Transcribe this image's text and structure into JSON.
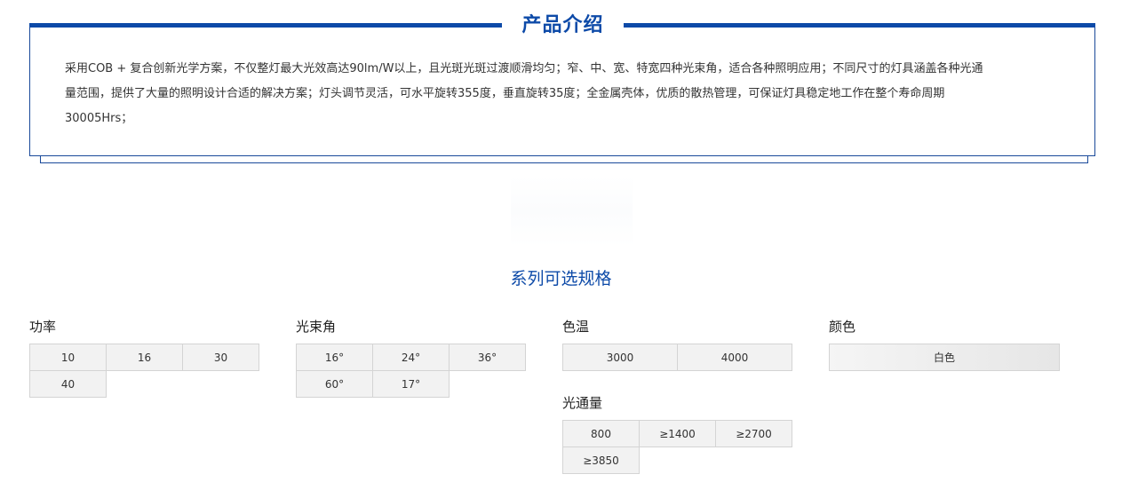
{
  "intro": {
    "title": "产品介绍",
    "line1": "采用COB + 复合创新光学方案，不仅整灯最大光效高达90lm/W以上，且光斑光斑过渡顺滑均匀；窄、中、宽、特宽四种光束角，适合各种照明应用；不同尺寸的灯具涵盖各种光通",
    "line2": "量范围，提供了大量的照明设计合适的解决方案；灯头调节灵活，可水平旋转355度，垂直旋转35度；全金属壳体，优质的散热管理，可保证灯具稳定地工作在整个寿命周期",
    "line3": "30005Hrs；"
  },
  "series": {
    "title": "系列可选规格",
    "power": {
      "label": "功率",
      "options": [
        "10",
        "16",
        "30",
        "40"
      ]
    },
    "beam": {
      "label": "光束角",
      "options": [
        "16°",
        "24°",
        "36°",
        "60°",
        "17°"
      ]
    },
    "cct": {
      "label": "色温",
      "options": [
        "3000",
        "4000"
      ]
    },
    "color": {
      "label": "颜色",
      "options": [
        "白色"
      ]
    },
    "flux": {
      "label": "光通量",
      "options": [
        "800",
        "≥1400",
        "≥2700",
        "≥3850"
      ]
    }
  },
  "colors": {
    "accent": "#0d4aa8",
    "cell_bg": "#f2f2f2",
    "cell_border": "#d4d4d4"
  }
}
